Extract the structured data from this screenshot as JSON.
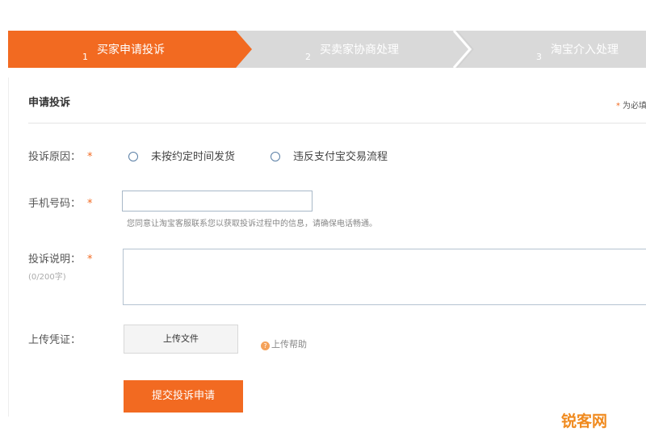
{
  "steps": [
    {
      "num": "1",
      "label": "买家申请投诉"
    },
    {
      "num": "2",
      "label": "买卖家协商处理"
    },
    {
      "num": "3",
      "label": "淘宝介入处理"
    }
  ],
  "panel": {
    "title": "申请投诉",
    "required_note": "为必填",
    "required_star": "*"
  },
  "form": {
    "reason": {
      "label": "投诉原因：",
      "star": "*",
      "options": [
        "未按约定时间发货",
        "违反支付宝交易流程"
      ]
    },
    "phone": {
      "label": "手机号码：",
      "star": "*",
      "value": "",
      "hint": "您同意让淘宝客服联系您以获取投诉过程中的信息，请确保电话畅通。"
    },
    "description": {
      "label": "投诉说明：",
      "star": "*",
      "counter": "(0/200字)",
      "value": ""
    },
    "evidence": {
      "label": "上传凭证：",
      "upload_label": "上传文件",
      "help_icon_glyph": "?",
      "help_label": "上传帮助"
    },
    "submit_label": "提交投诉申请"
  },
  "watermark": "锐客网",
  "colors": {
    "accent": "#f26a21",
    "inactive_step": "#d9d9d9"
  }
}
